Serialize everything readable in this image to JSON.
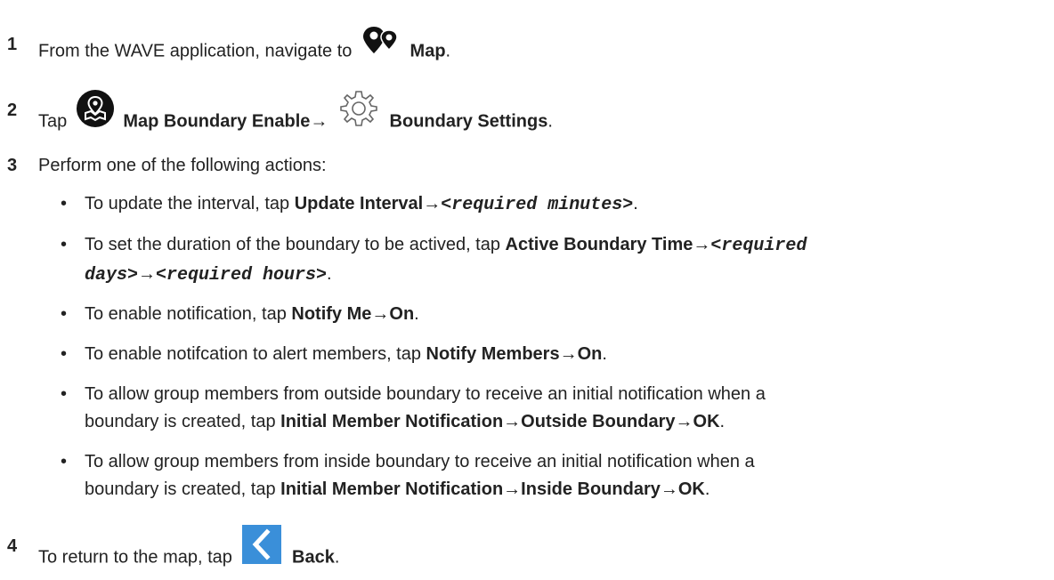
{
  "steps": [
    {
      "num": "1",
      "pre": "From the WAVE application, navigate to",
      "icon": "map-pins-icon",
      "bold": "Map",
      "post": "."
    },
    {
      "num": "2",
      "pre": "Tap",
      "icon1": "map-boundary-icon",
      "bold1": "Map Boundary Enable",
      "arrow": "→",
      "icon2": "gear-icon",
      "bold2": "Boundary Settings",
      "post": "."
    },
    {
      "num": "3",
      "text": "Perform one of the following actions:",
      "bullets": [
        {
          "pre": "To update the interval, tap ",
          "b1": "Update Interval",
          "a1": "→",
          "m1": "<required minutes>",
          "post": "."
        },
        {
          "pre": "To set the duration of the boundary to be actived, tap ",
          "b1": "Active Boundary Time",
          "a1": "→",
          "m1": "<required",
          "m2": "days>",
          "a2": "→",
          "m3": "<required hours>",
          "post": "."
        },
        {
          "pre": "To enable notification, tap ",
          "b1": "Notify Me",
          "a1": "→",
          "b2": "On",
          "post": "."
        },
        {
          "pre": "To enable notifcation to alert members, tap ",
          "b1": "Notify Members",
          "a1": "→",
          "b2": "On",
          "post": "."
        },
        {
          "line1": "To allow group members from outside boundary to receive an initial notification when a",
          "pre": "boundary is created, tap ",
          "b1": "Initial Member Notification",
          "a1": "→",
          "b2": "Outside Boundary",
          "a2": "→",
          "b3": "OK",
          "post": "."
        },
        {
          "line1": "To allow group members from inside boundary to receive an initial notification when a",
          "pre": "boundary is created, tap ",
          "b1": "Initial Member Notification",
          "a1": "→",
          "b2": "Inside Boundary",
          "a2": "→",
          "b3": "OK",
          "post": "."
        }
      ],
      "bullet_char": "•"
    },
    {
      "num": "4",
      "pre": "To return to the map, tap",
      "icon": "back-chevron-icon",
      "bold": "Back",
      "post": ".",
      "icon_color": "#3a8fd9"
    }
  ]
}
